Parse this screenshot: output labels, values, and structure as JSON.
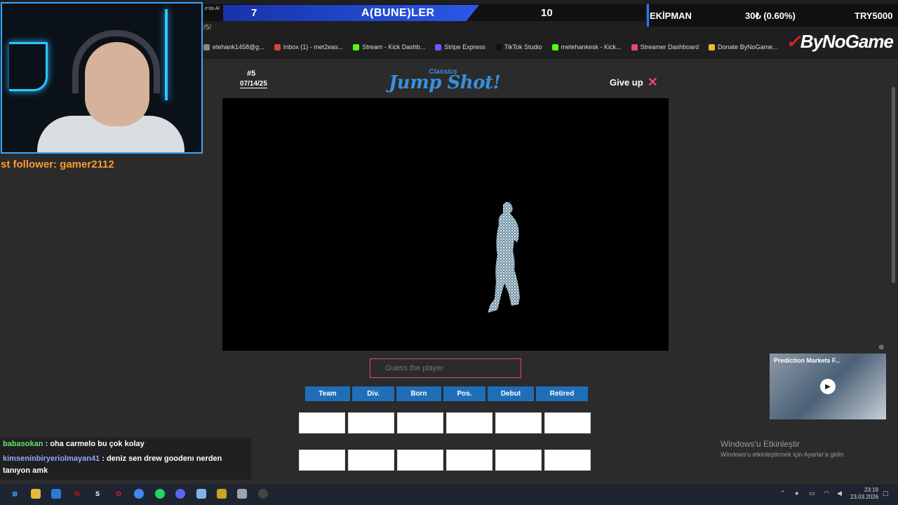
{
  "overlay": {
    "score_left": "7",
    "team_name": "A(BUNE)LER",
    "score_right": "10",
    "ekip_label": "EKİPMAN",
    "ekip_pct": "30₺ (0.60%)",
    "ekip_try": "TRY5000",
    "tiny_top": "e'da Al",
    "last_follower": "st follower: gamer2112",
    "sponsor": "ByNoGame"
  },
  "browser": {
    "address": "/5/",
    "bookmarks": [
      {
        "label": "etehank1458@g...",
        "color": "#888888"
      },
      {
        "label": "Inbox (1) - met2eas...",
        "color": "#d44638"
      },
      {
        "label": "Stream - Kick Dashb...",
        "color": "#53fc18"
      },
      {
        "label": "Stripe Express",
        "color": "#635bff"
      },
      {
        "label": "TikTok Studio",
        "color": "#111111"
      },
      {
        "label": "metehankesk - Kick...",
        "color": "#53fc18"
      },
      {
        "label": "Streamer Dashboard",
        "color": "#e8486f"
      },
      {
        "label": "Donate ByNoGame...",
        "color": "#f2b632"
      }
    ]
  },
  "game": {
    "number": "#5",
    "date": "07/14/25",
    "logo_top": "Classics",
    "logo": "Jump Shot!",
    "give_up": "Give up",
    "guess_placeholder": "Guess the player",
    "chips": [
      {
        "label": "Team",
        "w": 64
      },
      {
        "label": "Div.",
        "w": 60
      },
      {
        "label": "Born",
        "w": 64
      },
      {
        "label": "Pos.",
        "w": 60
      },
      {
        "label": "Debut",
        "w": 66
      },
      {
        "label": "Retired",
        "w": 74
      }
    ]
  },
  "chat": [
    {
      "user": "babasokan",
      "msg": " : oha carmelo bu çok kolay"
    },
    {
      "user": "kimseninbiryeriolmayan41",
      "msg": " : deniz sen drew goodenı nerden"
    },
    {
      "user": "",
      "msg": "tanıyon amk"
    }
  ],
  "ad": {
    "title": "Prediction Markets F..."
  },
  "windows": {
    "activate_title": "Windows'u Etkinleştir",
    "activate_sub": "Windows'u etkinleştirmek için Ayarlar'a gidin.",
    "time": "23:19",
    "date": "23.03.2026"
  }
}
